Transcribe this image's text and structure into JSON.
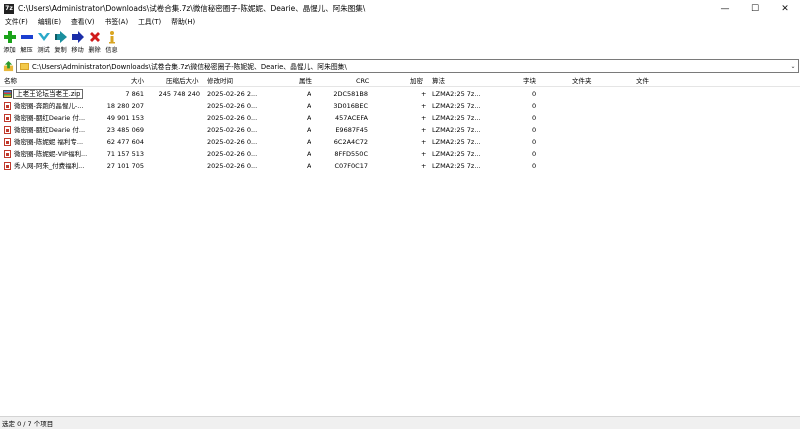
{
  "window": {
    "app_icon": "7z",
    "title": "C:\\Users\\Administrator\\Downloads\\试卷合集.7z\\微信秘密圈子-陈妮妮、Dearie、晶惺儿、阿朱图集\\",
    "minimize": "—",
    "maximize": "☐",
    "close": "✕"
  },
  "menu": [
    "文件(F)",
    "编辑(E)",
    "查看(V)",
    "书签(A)",
    "工具(T)",
    "帮助(H)"
  ],
  "toolbar": [
    {
      "label": "添加",
      "icon": "add-icon",
      "color": "#1aa31a"
    },
    {
      "label": "解压",
      "icon": "extract-icon",
      "color": "#1b3fd0"
    },
    {
      "label": "测试",
      "icon": "test-icon",
      "color": "#2aa9c9"
    },
    {
      "label": "复制",
      "icon": "copy-icon",
      "color": "#1a8f9e"
    },
    {
      "label": "移动",
      "icon": "move-icon",
      "color": "#1b2ea8"
    },
    {
      "label": "删除",
      "icon": "delete-icon",
      "color": "#d01b1b"
    },
    {
      "label": "信息",
      "icon": "info-icon",
      "color": "#d9a521"
    }
  ],
  "address": {
    "path": "C:\\Users\\Administrator\\Downloads\\试卷合集.7z\\微信秘密圈子-陈妮妮、Dearie、晶惺儿、阿朱图集\\",
    "dropdown": "⌄"
  },
  "columns": [
    "名称",
    "大小",
    "压缩后大小",
    "修改时间",
    "属性",
    "CRC",
    "加密",
    "算法",
    "字块",
    "文件夹",
    "文件"
  ],
  "rows": [
    {
      "name": "上老王论坛当老王.zip",
      "size": "7 861",
      "packed": "245 748 240",
      "modified": "2025-02-26 2...",
      "attr": "A",
      "crc": "2DC581B8",
      "enc": "+",
      "method": "LZMA2:25 7z...",
      "block": "0",
      "type": "zip"
    },
    {
      "name": "微密圈-奔跑的晶惺儿-...",
      "size": "18 280 207",
      "packed": "",
      "modified": "2025-02-26 0...",
      "attr": "A",
      "crc": "3D016BEC",
      "enc": "+",
      "method": "LZMA2:25 7z...",
      "block": "0",
      "type": "file"
    },
    {
      "name": "微密圈-胭红Dearie 付...",
      "size": "49 901 153",
      "packed": "",
      "modified": "2025-02-26 0...",
      "attr": "A",
      "crc": "457ACEFA",
      "enc": "+",
      "method": "LZMA2:25 7z...",
      "block": "0",
      "type": "file"
    },
    {
      "name": "微密圈-胭红Dearie 付...",
      "size": "23 485 069",
      "packed": "",
      "modified": "2025-02-26 0...",
      "attr": "A",
      "crc": "E9687F45",
      "enc": "+",
      "method": "LZMA2:25 7z...",
      "block": "0",
      "type": "file"
    },
    {
      "name": "微密圈-陈妮妮 福利专...",
      "size": "62 477 604",
      "packed": "",
      "modified": "2025-02-26 0...",
      "attr": "A",
      "crc": "6C2A4C72",
      "enc": "+",
      "method": "LZMA2:25 7z...",
      "block": "0",
      "type": "file"
    },
    {
      "name": "微密圈-陈妮妮-VIP福利...",
      "size": "71 157 513",
      "packed": "",
      "modified": "2025-02-26 0...",
      "attr": "A",
      "crc": "8FFD550C",
      "enc": "+",
      "method": "LZMA2:25 7z...",
      "block": "0",
      "type": "file"
    },
    {
      "name": "秀人网-阿朱_付费福利...",
      "size": "27 101 705",
      "packed": "",
      "modified": "2025-02-26 0...",
      "attr": "A",
      "crc": "C07F0C17",
      "enc": "+",
      "method": "LZMA2:25 7z...",
      "block": "0",
      "type": "file"
    }
  ],
  "status": "选定 0 / 7 个项目"
}
